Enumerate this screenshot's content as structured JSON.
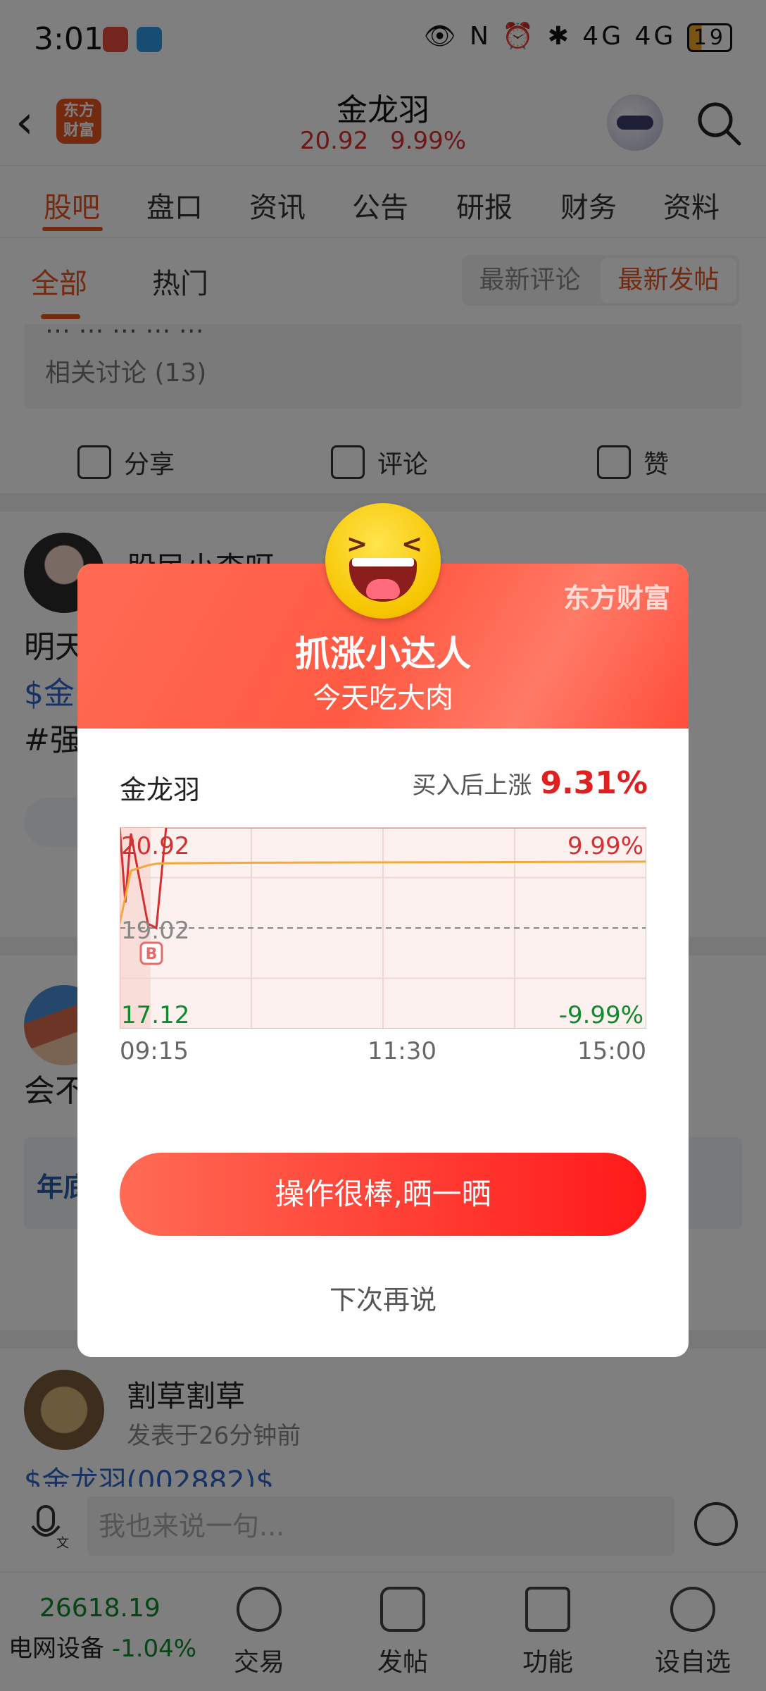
{
  "status": {
    "time": "3:01",
    "battery": "19",
    "icons": "👁 N ⏰ ✱ 4G 4G"
  },
  "header": {
    "title": "金龙羽",
    "price": "20.92",
    "change": "9.99%",
    "logo": "东方\n财富"
  },
  "tabs": [
    "股吧",
    "盘口",
    "资讯",
    "公告",
    "研报",
    "财务",
    "资料"
  ],
  "subtabs": [
    "全部",
    "热门"
  ],
  "sort": [
    "最新评论",
    "最新发帖"
  ],
  "feed": {
    "cut_text": "…  …  …  …  …",
    "related": "相关讨论 (13)",
    "actions": {
      "share": "分享",
      "comment": "评论",
      "like": "赞"
    },
    "post2": {
      "name": "股民小李呀",
      "line1": "明天",
      "line2": "$金",
      "line3": "#强"
    },
    "post3": {
      "line1": "会不",
      "banner": "年底"
    },
    "post4": {
      "name": "割草割草",
      "time": "发表于26分钟前",
      "link": "$金龙羽(002882)$"
    }
  },
  "comment": {
    "placeholder": "我也来说一句..."
  },
  "bottom": {
    "index_value": "26618.19",
    "index_name": "电网设备",
    "index_change": "-1.04%",
    "nav": [
      "交易",
      "发帖",
      "功能",
      "设自选"
    ]
  },
  "dialog": {
    "brand": "东方财富",
    "title": "抓涨小达人",
    "subtitle": "今天吃大肉",
    "stock": "金龙羽",
    "gain_label": "买入后上涨",
    "gain_value": "9.31%",
    "share_button": "操作很棒,晒一晒",
    "later_button": "下次再说",
    "buy_marker": "B"
  },
  "chart_data": {
    "type": "line",
    "x_labels": [
      "09:15",
      "11:30",
      "15:00"
    ],
    "y_top_label": "20.92",
    "y_mid_label": "19.02",
    "y_bottom_label": "17.12",
    "pct_top_label": "9.99%",
    "pct_bottom_label": "-9.99%",
    "ylim": [
      17.12,
      20.92
    ],
    "series": [
      {
        "values": [
          20.92,
          19.5,
          20.8,
          19.1,
          19.02,
          20.92,
          20.92,
          20.92,
          20.92
        ],
        "color": "#d43030"
      },
      {
        "values": [
          19.1,
          19.6,
          20.1,
          20.2,
          20.23,
          20.24,
          20.25,
          20.26,
          20.27
        ],
        "color": "#f2a93b"
      }
    ]
  }
}
